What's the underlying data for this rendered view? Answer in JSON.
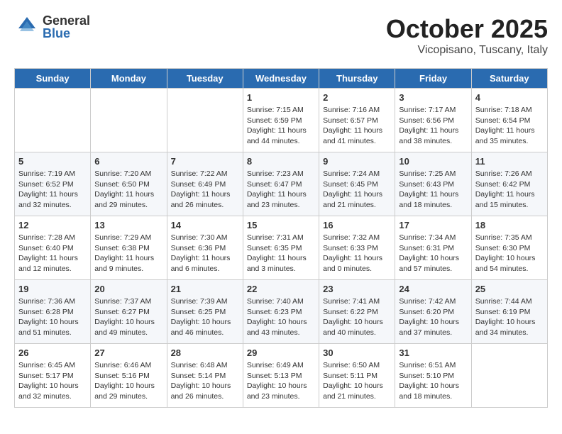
{
  "header": {
    "logo_general": "General",
    "logo_blue": "Blue",
    "month": "October 2025",
    "location": "Vicopisano, Tuscany, Italy"
  },
  "days_of_week": [
    "Sunday",
    "Monday",
    "Tuesday",
    "Wednesday",
    "Thursday",
    "Friday",
    "Saturday"
  ],
  "weeks": [
    {
      "days": [
        {
          "num": null,
          "info": null
        },
        {
          "num": null,
          "info": null
        },
        {
          "num": null,
          "info": null
        },
        {
          "num": "1",
          "info": "Sunrise: 7:15 AM\nSunset: 6:59 PM\nDaylight: 11 hours\nand 44 minutes."
        },
        {
          "num": "2",
          "info": "Sunrise: 7:16 AM\nSunset: 6:57 PM\nDaylight: 11 hours\nand 41 minutes."
        },
        {
          "num": "3",
          "info": "Sunrise: 7:17 AM\nSunset: 6:56 PM\nDaylight: 11 hours\nand 38 minutes."
        },
        {
          "num": "4",
          "info": "Sunrise: 7:18 AM\nSunset: 6:54 PM\nDaylight: 11 hours\nand 35 minutes."
        }
      ]
    },
    {
      "days": [
        {
          "num": "5",
          "info": "Sunrise: 7:19 AM\nSunset: 6:52 PM\nDaylight: 11 hours\nand 32 minutes."
        },
        {
          "num": "6",
          "info": "Sunrise: 7:20 AM\nSunset: 6:50 PM\nDaylight: 11 hours\nand 29 minutes."
        },
        {
          "num": "7",
          "info": "Sunrise: 7:22 AM\nSunset: 6:49 PM\nDaylight: 11 hours\nand 26 minutes."
        },
        {
          "num": "8",
          "info": "Sunrise: 7:23 AM\nSunset: 6:47 PM\nDaylight: 11 hours\nand 23 minutes."
        },
        {
          "num": "9",
          "info": "Sunrise: 7:24 AM\nSunset: 6:45 PM\nDaylight: 11 hours\nand 21 minutes."
        },
        {
          "num": "10",
          "info": "Sunrise: 7:25 AM\nSunset: 6:43 PM\nDaylight: 11 hours\nand 18 minutes."
        },
        {
          "num": "11",
          "info": "Sunrise: 7:26 AM\nSunset: 6:42 PM\nDaylight: 11 hours\nand 15 minutes."
        }
      ]
    },
    {
      "days": [
        {
          "num": "12",
          "info": "Sunrise: 7:28 AM\nSunset: 6:40 PM\nDaylight: 11 hours\nand 12 minutes."
        },
        {
          "num": "13",
          "info": "Sunrise: 7:29 AM\nSunset: 6:38 PM\nDaylight: 11 hours\nand 9 minutes."
        },
        {
          "num": "14",
          "info": "Sunrise: 7:30 AM\nSunset: 6:36 PM\nDaylight: 11 hours\nand 6 minutes."
        },
        {
          "num": "15",
          "info": "Sunrise: 7:31 AM\nSunset: 6:35 PM\nDaylight: 11 hours\nand 3 minutes."
        },
        {
          "num": "16",
          "info": "Sunrise: 7:32 AM\nSunset: 6:33 PM\nDaylight: 11 hours\nand 0 minutes."
        },
        {
          "num": "17",
          "info": "Sunrise: 7:34 AM\nSunset: 6:31 PM\nDaylight: 10 hours\nand 57 minutes."
        },
        {
          "num": "18",
          "info": "Sunrise: 7:35 AM\nSunset: 6:30 PM\nDaylight: 10 hours\nand 54 minutes."
        }
      ]
    },
    {
      "days": [
        {
          "num": "19",
          "info": "Sunrise: 7:36 AM\nSunset: 6:28 PM\nDaylight: 10 hours\nand 51 minutes."
        },
        {
          "num": "20",
          "info": "Sunrise: 7:37 AM\nSunset: 6:27 PM\nDaylight: 10 hours\nand 49 minutes."
        },
        {
          "num": "21",
          "info": "Sunrise: 7:39 AM\nSunset: 6:25 PM\nDaylight: 10 hours\nand 46 minutes."
        },
        {
          "num": "22",
          "info": "Sunrise: 7:40 AM\nSunset: 6:23 PM\nDaylight: 10 hours\nand 43 minutes."
        },
        {
          "num": "23",
          "info": "Sunrise: 7:41 AM\nSunset: 6:22 PM\nDaylight: 10 hours\nand 40 minutes."
        },
        {
          "num": "24",
          "info": "Sunrise: 7:42 AM\nSunset: 6:20 PM\nDaylight: 10 hours\nand 37 minutes."
        },
        {
          "num": "25",
          "info": "Sunrise: 7:44 AM\nSunset: 6:19 PM\nDaylight: 10 hours\nand 34 minutes."
        }
      ]
    },
    {
      "days": [
        {
          "num": "26",
          "info": "Sunrise: 6:45 AM\nSunset: 5:17 PM\nDaylight: 10 hours\nand 32 minutes."
        },
        {
          "num": "27",
          "info": "Sunrise: 6:46 AM\nSunset: 5:16 PM\nDaylight: 10 hours\nand 29 minutes."
        },
        {
          "num": "28",
          "info": "Sunrise: 6:48 AM\nSunset: 5:14 PM\nDaylight: 10 hours\nand 26 minutes."
        },
        {
          "num": "29",
          "info": "Sunrise: 6:49 AM\nSunset: 5:13 PM\nDaylight: 10 hours\nand 23 minutes."
        },
        {
          "num": "30",
          "info": "Sunrise: 6:50 AM\nSunset: 5:11 PM\nDaylight: 10 hours\nand 21 minutes."
        },
        {
          "num": "31",
          "info": "Sunrise: 6:51 AM\nSunset: 5:10 PM\nDaylight: 10 hours\nand 18 minutes."
        },
        {
          "num": null,
          "info": null
        }
      ]
    }
  ]
}
